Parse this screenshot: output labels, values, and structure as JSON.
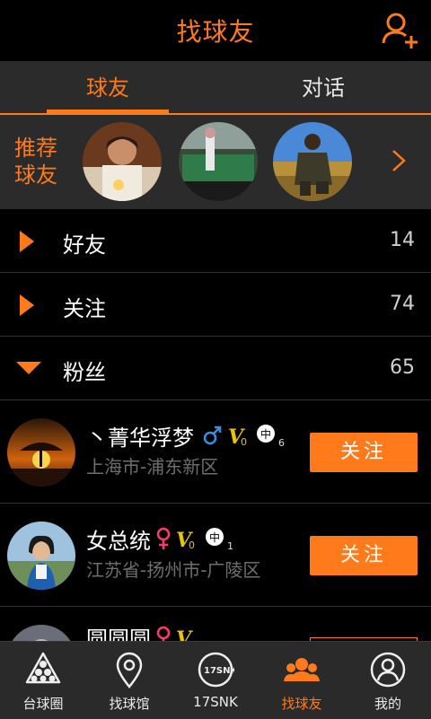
{
  "header": {
    "title": "找球友"
  },
  "tabs": [
    {
      "label": "球友",
      "active": true
    },
    {
      "label": "对话",
      "active": false
    }
  ],
  "recommend": {
    "label_line1": "推荐",
    "label_line2": "球友"
  },
  "groups": [
    {
      "name": "好友",
      "count": "14",
      "expanded": false
    },
    {
      "name": "关注",
      "count": "74",
      "expanded": false
    },
    {
      "name": "粉丝",
      "count": "65",
      "expanded": true
    }
  ],
  "fans": [
    {
      "nickname": "丶菁华浮梦",
      "location": "上海市-浦东新区",
      "gender": "male",
      "level": "6",
      "button": "关注"
    },
    {
      "nickname": "女总统",
      "location": "江苏省-扬州市-广陵区",
      "gender": "female",
      "level": "1",
      "button": "关注"
    },
    {
      "nickname": "圆圆圆",
      "location": "",
      "gender": "female",
      "level": "",
      "button": ""
    }
  ],
  "badges": {
    "v_label": "V",
    "v_sub": "0",
    "mid": "中"
  },
  "bottom_nav": [
    {
      "label": "台球圈",
      "icon": "billiard-rack-icon",
      "active": false
    },
    {
      "label": "找球馆",
      "icon": "location-pin-icon",
      "active": false
    },
    {
      "label": "17SNK",
      "icon": "snk-logo-icon",
      "active": false
    },
    {
      "label": "找球友",
      "icon": "friends-icon",
      "active": true
    },
    {
      "label": "我的",
      "icon": "user-icon",
      "active": false
    }
  ],
  "colors": {
    "accent": "#ff7a1a",
    "male": "#3a8fe0",
    "female": "#ff3a6a",
    "v": "#e8c300"
  }
}
